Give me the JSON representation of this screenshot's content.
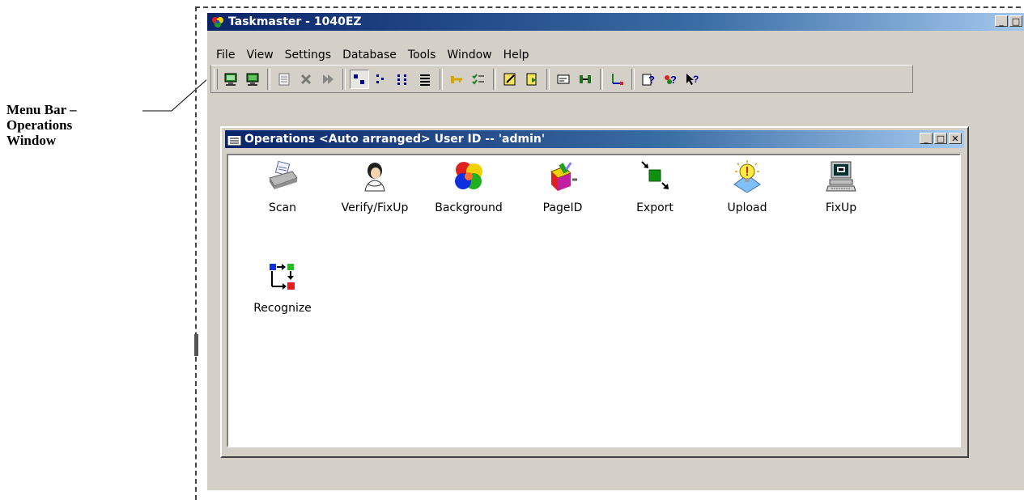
{
  "annotation": {
    "line1": "Menu Bar  –",
    "line2": "Operations",
    "line3": "Window"
  },
  "app": {
    "title": "Taskmaster - 1040EZ",
    "min": "_",
    "max": "□",
    "close": "✕"
  },
  "menu": [
    "File",
    "View",
    "Settings",
    "Database",
    "Tools",
    "Window",
    "Help"
  ],
  "toolbar_icons": [
    "computer-green-icon",
    "computer-green-icon",
    "properties-icon",
    "delete-icon",
    "forward-icon",
    "large-icons-icon",
    "small-icons-icon",
    "list-icon",
    "details-icon",
    "key-icon",
    "checklist-icon",
    "edit-icon",
    "document-icon",
    "form-icon",
    "batch-icon",
    "workflow-icon",
    "help-topics-icon",
    "help-users-icon",
    "context-help-icon"
  ],
  "operations_window": {
    "title": "Operations <Auto arranged>  User ID -- 'admin'",
    "min": "_",
    "max": "□",
    "close": "✕",
    "items": [
      {
        "label": "Scan",
        "icon": "scanner-icon"
      },
      {
        "label": "Verify/FixUp",
        "icon": "person-icon"
      },
      {
        "label": "Background",
        "icon": "color-wheel-icon"
      },
      {
        "label": "PageID",
        "icon": "pageid-icon"
      },
      {
        "label": "Export",
        "icon": "export-icon"
      },
      {
        "label": "Upload",
        "icon": "lightbulb-icon"
      },
      {
        "label": "FixUp",
        "icon": "computer-icon"
      },
      {
        "label": "Recognize",
        "icon": "recognize-icon"
      }
    ]
  }
}
